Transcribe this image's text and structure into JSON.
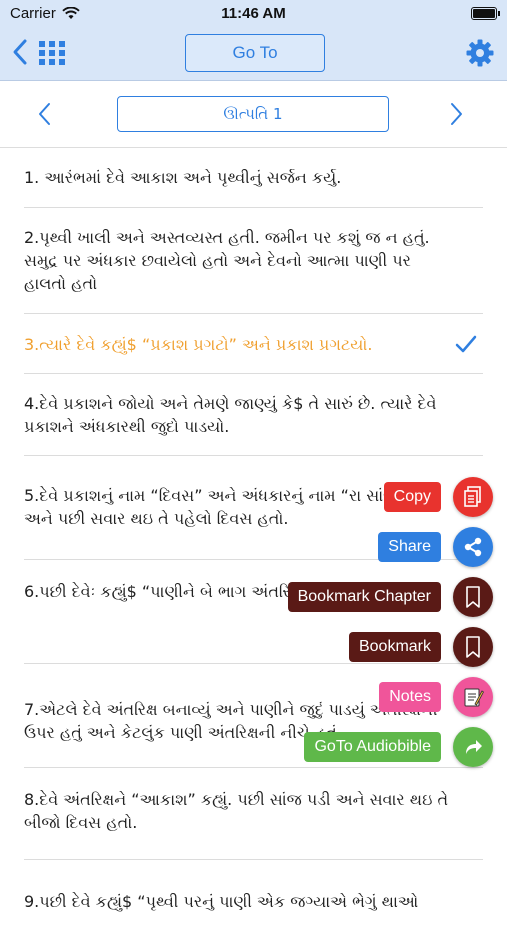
{
  "status": {
    "carrier": "Carrier",
    "time": "11:46 AM"
  },
  "nav": {
    "goto_label": "Go To"
  },
  "chapter": {
    "title": "ઊત્પતિ 1"
  },
  "verses": [
    {
      "text": "1. આરંભમાં દેવે આકાશ અને પૃથ્વીનું સર્જન કર્યુ.",
      "selected": false
    },
    {
      "text": "2.પૃથ્વી ખાલી અને અસ્તવ્યસ્ત હતી. જમીન પર કશું જ ન હતું. સમુદ્ર પર અંધકાર છવાયેલો હતો અને દેવનો આત્મા પાણી પર હાલતો હતો",
      "selected": false
    },
    {
      "text": "3.ત્યારે દેવે કહ્યું$ “પ્રકાશ પ્રગટો” અને પ્રકાશ પ્રગટયો.",
      "selected": true
    },
    {
      "text": "4.દેવે પ્રકાશને જોયો અને તેમણે જાણ્યું કે$ તે સારું છે. ત્યારે દેવે પ્રકાશને અંધકારથી જુદો પાડયો.",
      "selected": false
    },
    {
      "text": "5.દેવે પ્રકાશનું નામ “દિવસ” અને અંધકારનું નામ “રા સાંજ પડી અને પછી સવાર થઇ તે પહેલો દિવસ હતો.",
      "selected": false
    },
    {
      "text": "6.પછી દેવેઃ કહ્યું$ “પાણીને બે ભાગ અંતરિક્ષ થાઓ.”",
      "selected": false
    },
    {
      "text": "7.એટલે દેવે અંતરિક્ષ બનાવ્યું અને પાણીને જુદું પાડયું અંતરિક્ષની ઉપર હતું અને કેટલુંક પાણી અંતરિક્ષની નીચે હતું.",
      "selected": false
    },
    {
      "text": "8.દેવે અંતરિક્ષને “આકાશ” કહ્યું. પછી સાંજ પડી અને સવાર થઇ તે બીજો દિવસ હતો.",
      "selected": false
    },
    {
      "text": "9.પછી દેવે કહ્યું$ “પૃથ્વી પરનું પાણી એક જગ્યાએ ભેગું થાઓ",
      "selected": false
    }
  ],
  "actions": {
    "copy": "Copy",
    "share": "Share",
    "bookmark_chapter": "Bookmark Chapter",
    "bookmark": "Bookmark",
    "notes": "Notes",
    "goto_audio": "GoTo Audiobible"
  },
  "colors": {
    "accent": "#2f7fe0",
    "selected_verse": "#f0a030",
    "copy": "#e8332e",
    "share": "#2f7fe0",
    "bookmark": "#5a1a16",
    "notes": "#f0559a",
    "audio": "#5fb84a"
  }
}
